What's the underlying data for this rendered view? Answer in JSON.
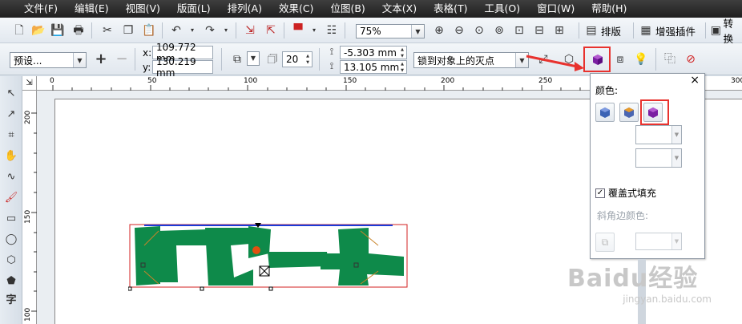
{
  "menubar": {
    "items": [
      "文件(F)",
      "编辑(E)",
      "视图(V)",
      "版面(L)",
      "排列(A)",
      "效果(C)",
      "位图(B)",
      "文本(X)",
      "表格(T)",
      "工具(O)",
      "窗口(W)",
      "帮助(H)"
    ]
  },
  "toolbar1": {
    "zoom": "75%",
    "paiban": "排版",
    "plugin": "增强插件",
    "convert": "转换"
  },
  "toolbar2": {
    "preset": "预设...",
    "x_label": "x:",
    "x_value": "109.772 mm",
    "y_label": "y:",
    "y_value": "130.219 mm",
    "depth_value": "20",
    "vp_x": "-5.303 mm",
    "vp_y": "13.105 mm",
    "vanish_lock": "锁到对象上的灭点"
  },
  "ruler": {
    "h_ticks": [
      "0",
      "50",
      "100",
      "150",
      "200",
      "250",
      "300"
    ],
    "v_ticks": [
      "200",
      "150",
      "100"
    ],
    "corner": "⇲"
  },
  "artwork": {
    "fill_color": "#0e8a4a",
    "outline_color": "#d32020"
  },
  "popup": {
    "color_label": "颜色:",
    "overlay_fill_label": "覆盖式填充",
    "overlay_fill_checked": true,
    "bevel_color_label": "斜角边颜色:",
    "close": "×"
  },
  "watermark": {
    "text": "Baidu经验",
    "url": "jingyan.baidu.com"
  },
  "colors": {
    "menubar": "#2b2b2b",
    "highlight": "#e8322e",
    "purple": "#7a1fa2"
  }
}
